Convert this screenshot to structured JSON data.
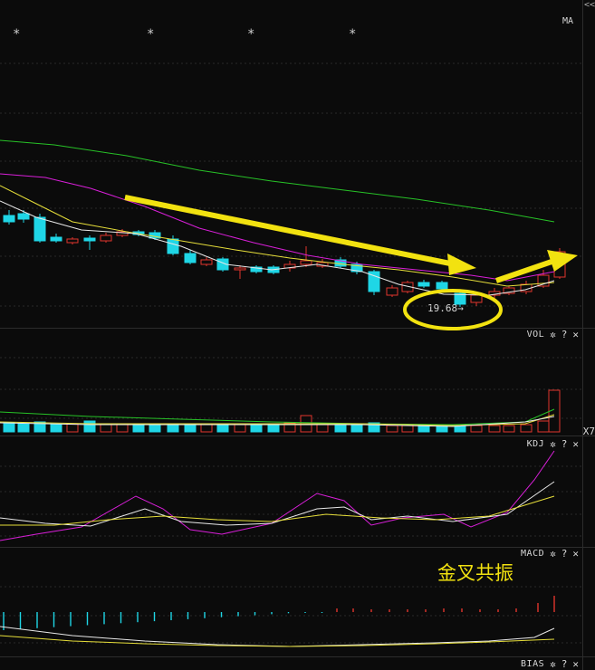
{
  "top_right_glyph": "<<",
  "main_panel": {
    "ma_label": "MA",
    "star_symbol": "*",
    "price_low_label": "19.68",
    "price_low_arrow": "→"
  },
  "vol_panel": {
    "label": "VOL",
    "right_label": "X7"
  },
  "kdj_panel": {
    "label": "KDJ"
  },
  "macd_panel": {
    "label": "MACD",
    "annotation": "金叉共振"
  },
  "bias_panel": {
    "label": "BIAS"
  },
  "panel_buttons": {
    "settings": "✲",
    "help": "?",
    "close": "✕"
  },
  "colors": {
    "background": "#0b0b0b",
    "up_candle": "#e0362c",
    "down_candle": "#1fd6e6",
    "ma_white": "#e8e8e8",
    "ma_yellow": "#e6de3a",
    "ma_magenta": "#d81fd8",
    "ma_green": "#27c227",
    "annotation_yellow": "#f2e210"
  },
  "icons": [
    "settings-gear-icon",
    "help-icon",
    "close-icon",
    "trend-arrow-icon",
    "circle-highlight-icon"
  ]
}
